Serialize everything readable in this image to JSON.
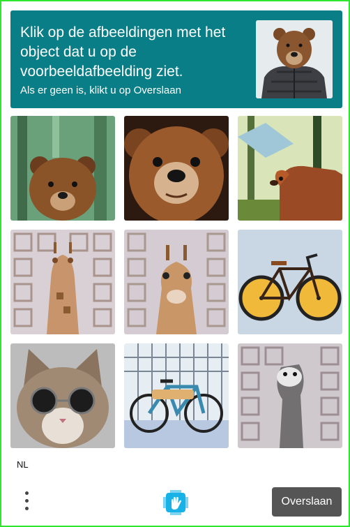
{
  "header": {
    "prompt": "Klik op de afbeeldingen met het object dat u op de voorbeeldafbeelding ziet.",
    "subprompt": "Als er geen is, klikt u op Overslaan",
    "background_color": "#0a7e86",
    "example_image": "bear-in-puffer-jacket"
  },
  "grid": {
    "tiles": [
      {
        "subject": "bear-head-forest"
      },
      {
        "subject": "bear-head-closeup"
      },
      {
        "subject": "bear-walking-forest"
      },
      {
        "subject": "giraffe-pattern-background"
      },
      {
        "subject": "giraffe-pattern-background"
      },
      {
        "subject": "bicycle-yellow-wheels"
      },
      {
        "subject": "cat-with-sunglasses"
      },
      {
        "subject": "bicycle-city-street"
      },
      {
        "subject": "giraffe-grayscale-pattern"
      }
    ]
  },
  "footer": {
    "language": "NL",
    "skip_label": "Overslaan",
    "menu_icon": "more-vertical-icon",
    "logo_icon": "hcaptcha-logo-icon"
  },
  "colors": {
    "border": "#2ee62e",
    "button": "#555555"
  }
}
